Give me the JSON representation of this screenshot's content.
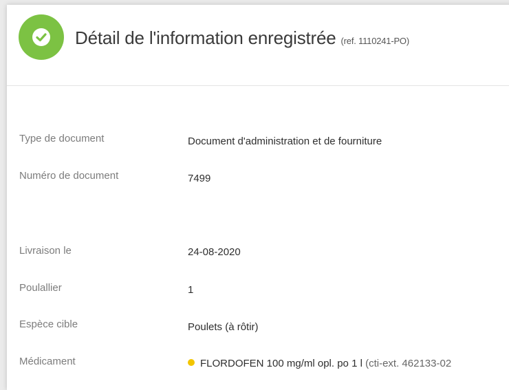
{
  "header": {
    "title": "Détail de l'information enregistrée",
    "ref": "(ref. 1110241-PO)"
  },
  "details": {
    "doc_type_label": "Type de document",
    "doc_type_value": "Document d'administration et de fourniture",
    "doc_number_label": "Numéro de document",
    "doc_number_value": "7499",
    "delivery_label": "Livraison le",
    "delivery_value": "24-08-2020",
    "house_label": "Poulallier",
    "house_value": "1",
    "species_label": "Espèce cible",
    "species_value": "Poulets (à rôtir)",
    "medication_label": "Médicament",
    "medication_name": "FLORDOFEN 100 mg/ml opl. po 1 l",
    "medication_code": "(cti-ext. 462133-02"
  },
  "icons": {
    "status": "check-circle-icon",
    "medication_status": "yellow-dot-icon"
  },
  "colors": {
    "success": "#7cc243",
    "warning_dot": "#f2c500"
  }
}
